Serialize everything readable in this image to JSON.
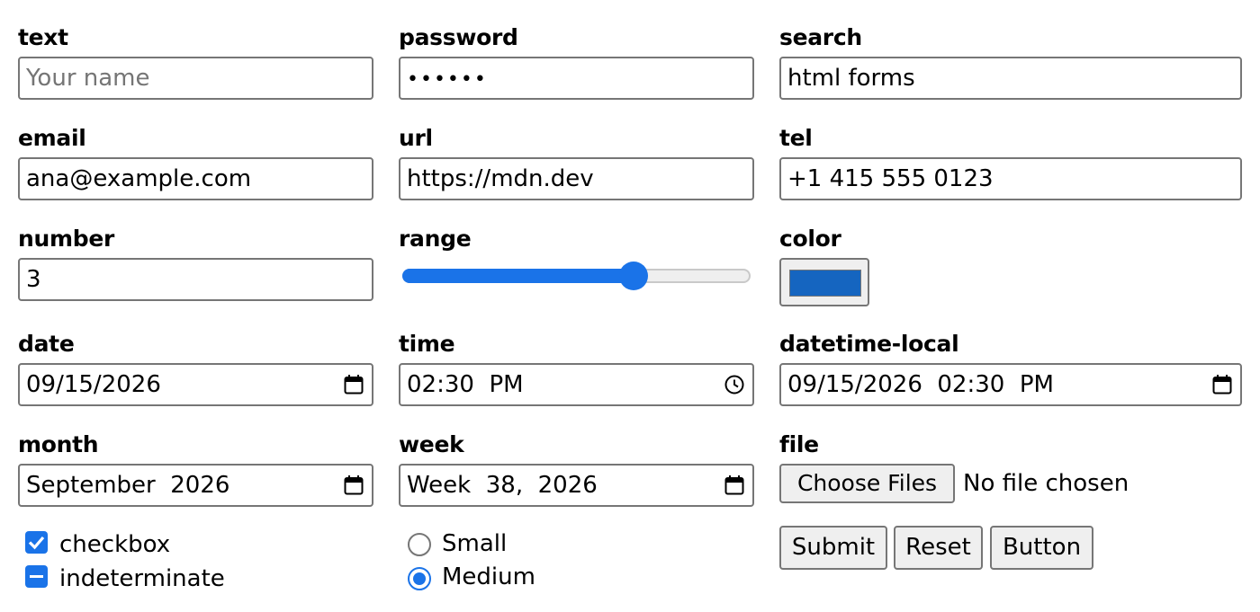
{
  "fields": {
    "text": {
      "label": "text",
      "placeholder": "Your name"
    },
    "password": {
      "label": "password",
      "value": "••••••"
    },
    "search": {
      "label": "search",
      "value": "html forms"
    },
    "email": {
      "label": "email",
      "value": "ana@example.com"
    },
    "url": {
      "label": "url",
      "value": "https://mdn.dev"
    },
    "tel": {
      "label": "tel",
      "value": "+1 415 555 0123"
    },
    "number": {
      "label": "number",
      "value": "3"
    },
    "range": {
      "label": "range",
      "value_fraction": 0.68,
      "accent": "#1a73e8"
    },
    "color": {
      "label": "color",
      "value": "#1565c0"
    },
    "date": {
      "label": "date",
      "value": "09/15/2026",
      "icon": "calendar-icon"
    },
    "time": {
      "label": "time",
      "value": "02:30  PM",
      "icon": "clock-icon"
    },
    "datetime_local": {
      "label": "datetime-local",
      "value": "09/15/2026  02:30  PM",
      "icon": "calendar-icon"
    },
    "month": {
      "label": "month",
      "value": "September  2026",
      "icon": "calendar-icon"
    },
    "week": {
      "label": "week",
      "value": "Week  38,  2026",
      "icon": "calendar-icon"
    },
    "file": {
      "label": "file",
      "button": "Choose Files",
      "status": "No file chosen"
    }
  },
  "checkboxes": [
    {
      "label": "checkbox",
      "state": "checked"
    },
    {
      "label": "indeterminate",
      "state": "indeterminate"
    }
  ],
  "radios": [
    {
      "label": "Small",
      "checked": false
    },
    {
      "label": "Medium",
      "checked": true
    }
  ],
  "buttons": {
    "submit": "Submit",
    "reset": "Reset",
    "button": "Button"
  },
  "colors": {
    "accent": "#1a73e8",
    "border": "#767676",
    "button_bg": "#efefef"
  }
}
